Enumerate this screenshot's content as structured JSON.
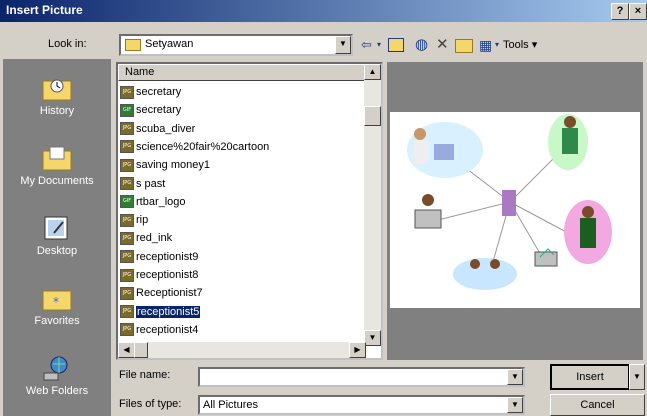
{
  "window": {
    "title": "Insert Picture",
    "help_glyph": "?",
    "close_glyph": "×"
  },
  "lookin": {
    "label": "Look in:",
    "value": "Setyawan"
  },
  "toolbar": {
    "tools_label": "Tools"
  },
  "places": [
    {
      "label": "History",
      "icon": "history-icon"
    },
    {
      "label": "My Documents",
      "icon": "my-documents-icon"
    },
    {
      "label": "Desktop",
      "icon": "desktop-icon"
    },
    {
      "label": "Favorites",
      "icon": "favorites-icon"
    },
    {
      "label": "Web Folders",
      "icon": "web-folders-icon"
    }
  ],
  "filelist": {
    "header": "Name",
    "files": [
      {
        "name": "secretary",
        "type": "JPG"
      },
      {
        "name": "secretary",
        "type": "GIF"
      },
      {
        "name": "scuba_diver",
        "type": "JPG"
      },
      {
        "name": "science%20fair%20cartoon",
        "type": "JPG"
      },
      {
        "name": "saving money1",
        "type": "JPG"
      },
      {
        "name": "s past",
        "type": "JPG"
      },
      {
        "name": "rtbar_logo",
        "type": "GIF"
      },
      {
        "name": "rip",
        "type": "JPG"
      },
      {
        "name": "red_ink",
        "type": "JPG"
      },
      {
        "name": "receptionist9",
        "type": "JPG"
      },
      {
        "name": "receptionist8",
        "type": "JPG"
      },
      {
        "name": "Receptionist7",
        "type": "JPG"
      },
      {
        "name": "receptionist5",
        "type": "JPG"
      },
      {
        "name": "receptionist4",
        "type": "JPG"
      }
    ],
    "selected_index": 12
  },
  "filename": {
    "label": "File name:",
    "value": ""
  },
  "filetype": {
    "label": "Files of type:",
    "value": "All Pictures"
  },
  "buttons": {
    "insert": "Insert",
    "cancel": "Cancel"
  },
  "colors": {
    "title_start": "#0a246a",
    "title_end": "#a6caf0",
    "selection": "#0a246a",
    "dialog_bg": "#d4d0c8"
  }
}
